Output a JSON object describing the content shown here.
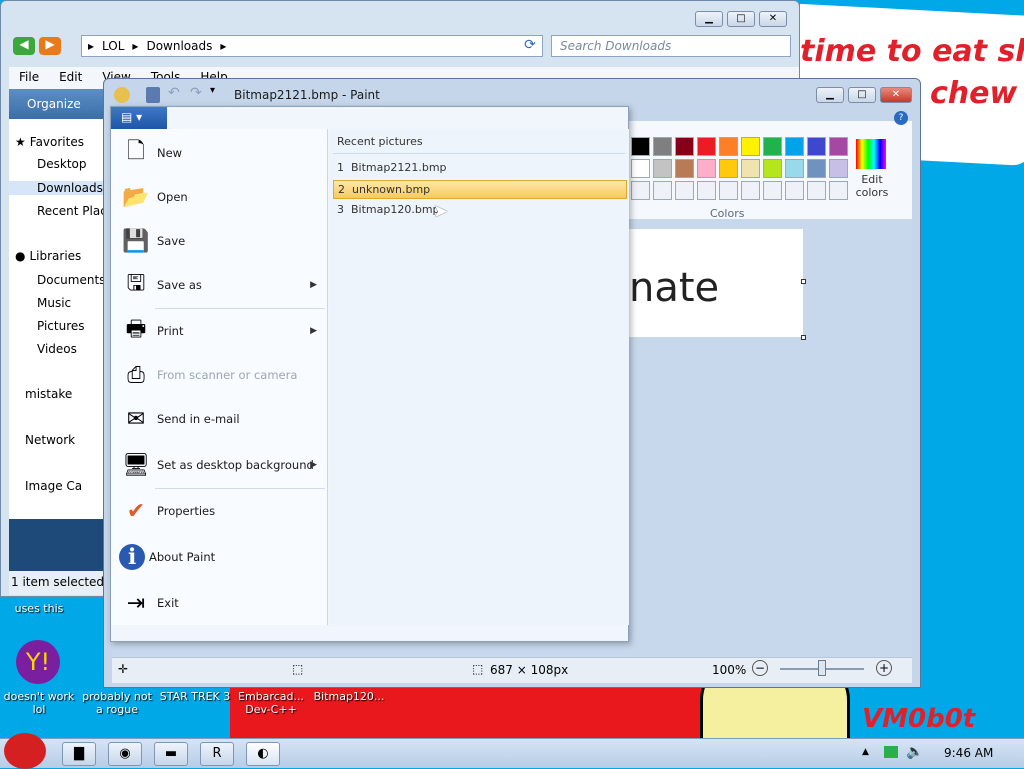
{
  "wallpaper": {
    "text_line1": "time to eat shit",
    "text_line2": "chew",
    "signature": "VM0b0t"
  },
  "explorer": {
    "address": [
      "LOL",
      "Downloads"
    ],
    "search_placeholder": "Search Downloads",
    "menu": [
      "File",
      "Edit",
      "View",
      "Tools",
      "Help"
    ],
    "organize": "Organize",
    "nav": [
      "Favorites",
      "Desktop",
      "Downloads",
      "Recent Places",
      "Libraries",
      "Documents",
      "Music",
      "Pictures",
      "Videos",
      "mistake",
      "Network",
      "Image Ca"
    ],
    "status": "1 item selected"
  },
  "paint": {
    "title": "Bitmap2121.bmp - Paint",
    "canvas_text": "nate",
    "colors_label": "Colors",
    "edit_colors": "Edit colors",
    "size": "687 × 108px",
    "zoom": "100%",
    "palette_row1": [
      "#000000",
      "#7f7f7f",
      "#880015",
      "#ed1c24",
      "#ff7f27",
      "#fff200",
      "#22b14c",
      "#00a2e8",
      "#3f48cc",
      "#a349a4"
    ],
    "palette_row2": [
      "#ffffff",
      "#c3c3c3",
      "#b97a57",
      "#ffaec9",
      "#ffc90e",
      "#efe4b0",
      "#b5e61d",
      "#99d9ea",
      "#7092be",
      "#c8bfe7"
    ]
  },
  "appmenu": {
    "items": [
      {
        "label": "New",
        "icon": "new-file-icon",
        "arrow": false
      },
      {
        "label": "Open",
        "icon": "open-folder-icon",
        "arrow": false
      },
      {
        "label": "Save",
        "icon": "save-disk-icon",
        "arrow": false
      },
      {
        "label": "Save as",
        "icon": "save-as-icon",
        "arrow": true
      },
      {
        "label": "Print",
        "icon": "printer-icon",
        "arrow": true
      },
      {
        "label": "From scanner or camera",
        "icon": "scanner-icon",
        "arrow": false
      },
      {
        "label": "Send in e-mail",
        "icon": "email-icon",
        "arrow": false
      },
      {
        "label": "Set as desktop background",
        "icon": "desktop-background-icon",
        "arrow": true
      },
      {
        "label": "Properties",
        "icon": "checkmark-icon",
        "arrow": false
      },
      {
        "label": "About Paint",
        "icon": "info-icon",
        "arrow": false
      },
      {
        "label": "Exit",
        "icon": "exit-icon",
        "arrow": false
      }
    ],
    "recent_header": "Recent pictures",
    "recent": [
      {
        "n": "1",
        "name": "Bitmap2121.bmp"
      },
      {
        "n": "2",
        "name": "unknown.bmp"
      },
      {
        "n": "3",
        "name": "Bitmap120.bmp"
      }
    ]
  },
  "desktop": {
    "labels": [
      "uses this",
      "doesn't work lol",
      "probably not a rogue",
      "STAR TREK 3",
      "Embarcad... Dev-C++",
      "Bitmap120..."
    ]
  },
  "taskbar": {
    "time": "9:46 AM"
  }
}
